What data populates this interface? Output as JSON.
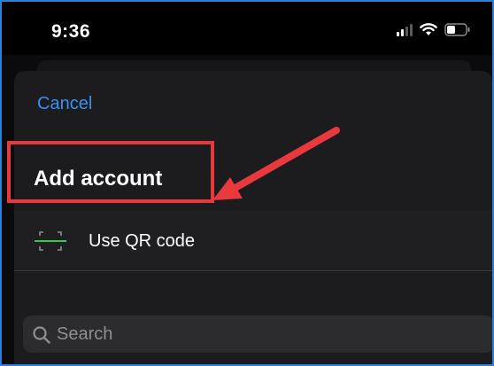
{
  "status_bar": {
    "time": "9:36",
    "icons": [
      "cellular-signal-icon",
      "wifi-icon",
      "battery-icon"
    ]
  },
  "sheet": {
    "cancel_label": "Cancel",
    "title": "Add account",
    "qr_option": {
      "icon": "qr-scan-icon",
      "label": "Use QR code"
    },
    "search": {
      "icon": "search-icon",
      "placeholder": "Search",
      "value": ""
    }
  },
  "annotation": {
    "color": "#e8393f",
    "arrow_icon": "arrow-icon",
    "highlight": "qr-option"
  },
  "colors": {
    "accent": "#3a8ff0",
    "qr_icon_accent": "#34c759",
    "sheet_background": "#1c1c1e",
    "frame_border": "#2f7fd6"
  }
}
